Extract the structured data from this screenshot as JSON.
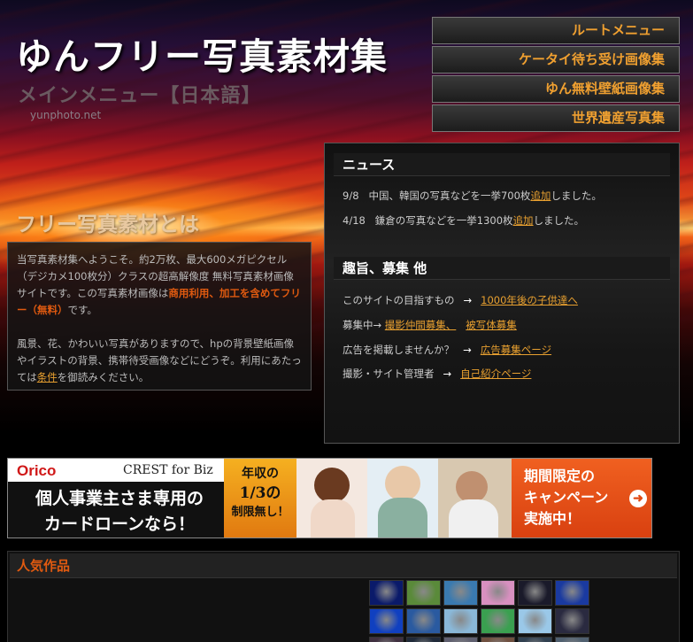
{
  "header": {
    "site_title": "ゆんフリー写真素材集",
    "main_menu_title": "メインメニュー【日本語】",
    "domain": "yunphoto.net"
  },
  "top_nav": [
    {
      "label": "ルートメニュー"
    },
    {
      "label": "ケータイ待ち受け画像集"
    },
    {
      "label": "ゆん無料壁紙画像集"
    },
    {
      "label": "世界遺産写真集"
    }
  ],
  "about": {
    "heading": "フリー写真素材とは",
    "para1_a": "当写真素材集へようこそ。約2万枚、最大600メガピクセル（デジカメ100枚分）クラスの超高解像度 無料写真素材画像サイトです。この写真素材画像は",
    "para1_accent": "商用利用、加工を含めてフリー（無料）",
    "para1_b": "です。",
    "para2_a": "風景、花、かわいい写真がありますので、hpの背景壁紙画像やイラストの背景、携帯待受画像などにどうぞ。利用にあたっては",
    "para2_link": "条件",
    "para2_b": "を御読みください。"
  },
  "news": {
    "heading": "ニュース",
    "items": [
      {
        "date": "9/8",
        "text": "中国、韓国の写真などを一挙700枚",
        "link": "追加",
        "suffix": "しました。"
      },
      {
        "date": "4/18",
        "text": "鎌倉の写真などを一挙1300枚",
        "link": "追加",
        "suffix": "しました。"
      }
    ]
  },
  "purpose": {
    "heading": "趣旨、募集 他",
    "rows": [
      {
        "label": "このサイトの目指すもの",
        "arrow": "→",
        "link1": "1000年後の子供達へ"
      },
      {
        "label": "募集中→",
        "link1": "撮影仲間募集、",
        "link2": "被写体募集"
      },
      {
        "label": "広告を掲載しませんか？",
        "arrow": "→",
        "link1": "広告募集ページ"
      },
      {
        "label": "撮影・サイト管理者",
        "arrow": "→",
        "link1": "自己紹介ページ"
      }
    ]
  },
  "banner": {
    "brand": "Orico",
    "brand_sub": "CREST for Biz",
    "copy_line1": "個人事業主さま専用の",
    "copy_line2": "カードローンなら！",
    "badge_line1": "年収の",
    "badge_line2": "1/3の",
    "badge_line3": "制限無し！",
    "cta_line1": "期間限定の",
    "cta_line2": "キャンペーン",
    "cta_line3": "実施中！",
    "cta_arrow": "➜"
  },
  "popular": {
    "heading": "人気作品"
  },
  "thumb_colors": [
    "#0a1a6a",
    "#5a8a3a",
    "#3a7ab0",
    "#d890c0",
    "#1a1a2a",
    "#1a3aa0",
    "#1040c0",
    "#2a5aa0",
    "#8ab8d8",
    "#3aa050",
    "#9ac8e8",
    "#2a2a40",
    "#403040",
    "#202a3a",
    "#606070",
    "#705040",
    "#304050",
    "#506070"
  ]
}
